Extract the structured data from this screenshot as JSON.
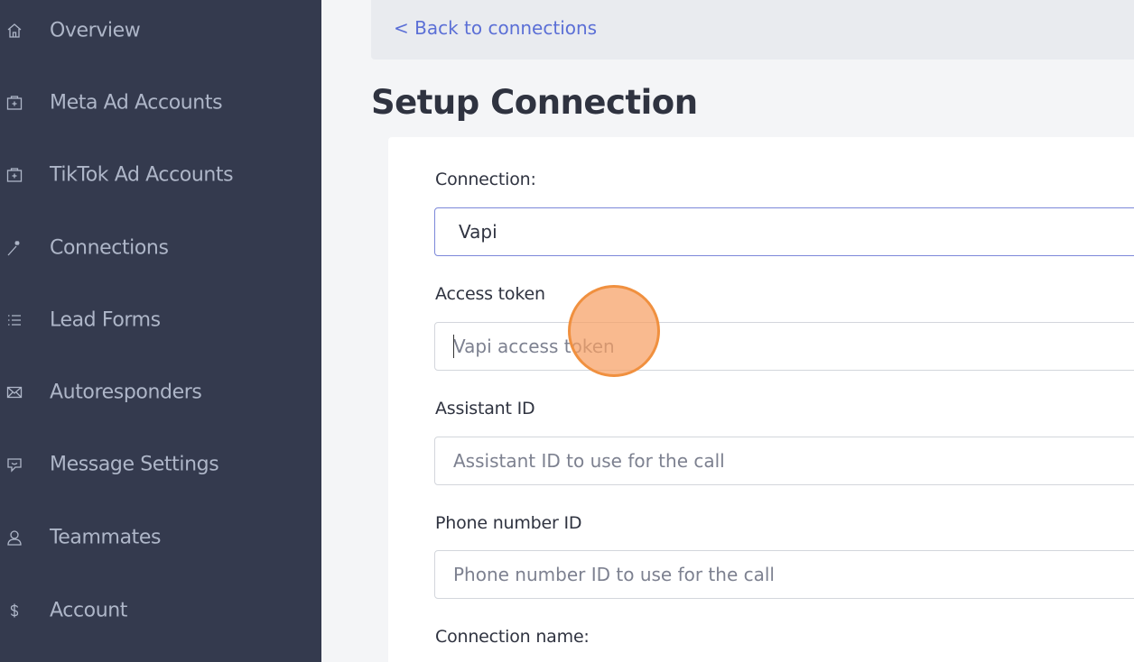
{
  "sidebar": {
    "items": [
      {
        "label": "Overview",
        "icon": "home-icon"
      },
      {
        "label": "Meta Ad Accounts",
        "icon": "folder-plus-icon"
      },
      {
        "label": "TikTok Ad Accounts",
        "icon": "folder-plus-icon"
      },
      {
        "label": "Connections",
        "icon": "magic-wand-icon"
      },
      {
        "label": "Lead Forms",
        "icon": "list-icon"
      },
      {
        "label": "Autoresponders",
        "icon": "mail-icon"
      },
      {
        "label": "Message Settings",
        "icon": "chat-icon"
      },
      {
        "label": "Teammates",
        "icon": "user-icon"
      },
      {
        "label": "Account",
        "icon": "dollar-icon"
      }
    ]
  },
  "header": {
    "back_link": "< Back to connections",
    "title": "Setup Connection"
  },
  "form": {
    "connection": {
      "label": "Connection:",
      "value": "Vapi"
    },
    "access_token": {
      "label": "Access token",
      "placeholder": "Vapi access token"
    },
    "assistant_id": {
      "label": "Assistant ID",
      "placeholder": "Assistant ID to use for the call"
    },
    "phone_number_id": {
      "label": "Phone number ID",
      "placeholder": "Phone number ID to use for the call"
    },
    "connection_name": {
      "label": "Connection name:"
    }
  },
  "colors": {
    "sidebar_bg": "#343a4e",
    "sidebar_text": "#aeb6c8",
    "link": "#5b6fd6",
    "focus_border": "#7c88d9",
    "click_indicator": "#f0903f"
  }
}
